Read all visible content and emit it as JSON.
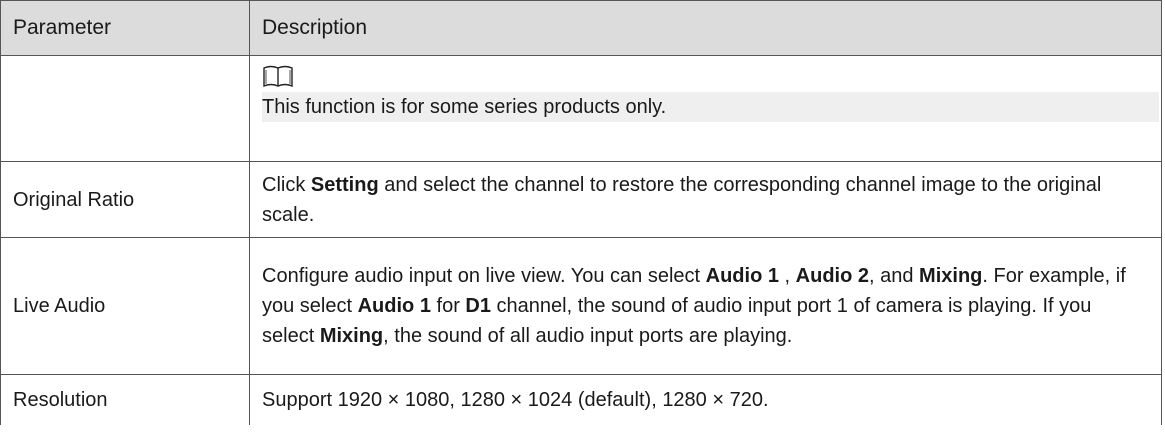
{
  "table": {
    "headers": {
      "parameter": "Parameter",
      "description": "Description"
    },
    "note_row": {
      "parameter": "",
      "icon": "book-note-icon",
      "note_text": "This function is for some series products only."
    },
    "original_ratio": {
      "parameter": "Original Ratio",
      "desc_part1": "Click ",
      "desc_bold1": "Setting",
      "desc_part2": " and select the channel to restore the corresponding channel image to the original scale."
    },
    "live_audio": {
      "parameter": "Live Audio",
      "t1": "Configure audio input on live view. You can select ",
      "b1": "Audio 1",
      "t2": " , ",
      "b2": "Audio 2",
      "t3": ", and ",
      "b3": "Mixing",
      "t4": ". For example, if you select ",
      "b4": "Audio 1",
      "t5": " for ",
      "b5": "D1",
      "t6": " channel, the sound of audio input port 1 of camera is playing. If you select ",
      "b6": "Mixing",
      "t7": ", the sound of all audio input ports are playing."
    },
    "resolution": {
      "parameter": "Resolution",
      "description": "Support 1920 × 1080, 1280 × 1024 (default), 1280 × 720."
    }
  }
}
